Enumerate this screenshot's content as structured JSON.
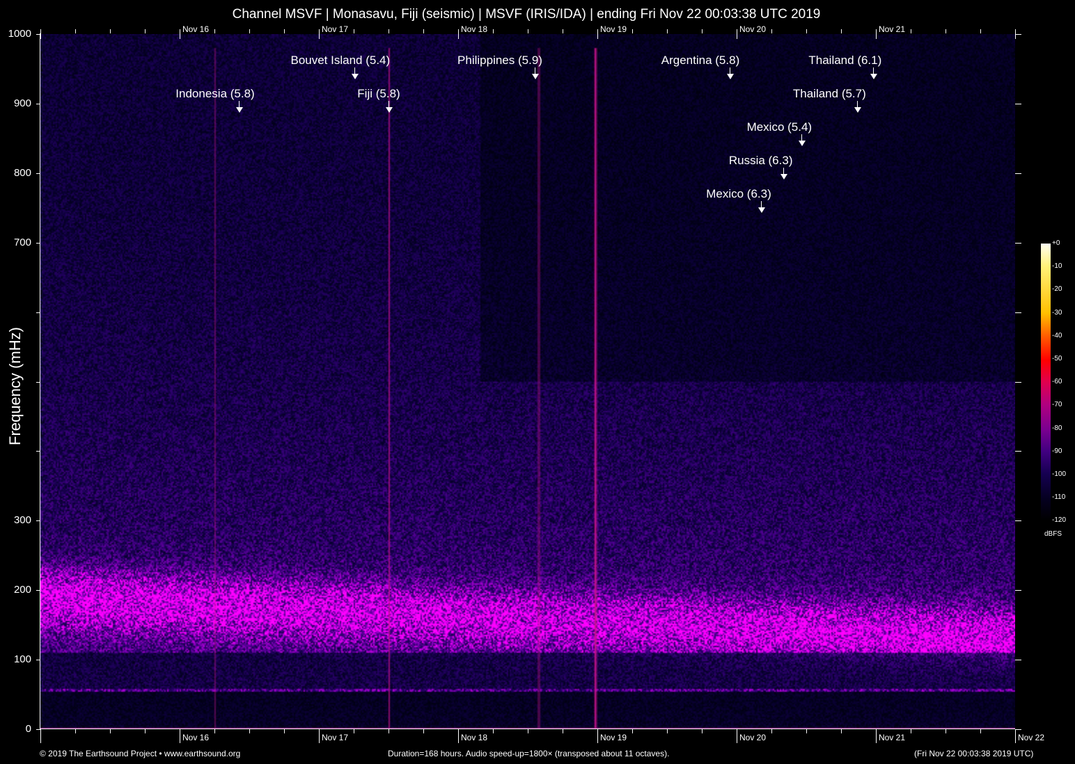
{
  "chart_data": {
    "type": "heatmap",
    "title": "Channel MSVF | Monasavu, Fiji (seismic) | MSVF (IRIS/IDA) | ending Fri Nov 22 00:03:38 UTC 2019",
    "ylabel": "Frequency (mHz)",
    "ylim": [
      0,
      1000
    ],
    "y_ticks": [
      0,
      100,
      200,
      300,
      400,
      500,
      600,
      700,
      800,
      900,
      1000
    ],
    "y_tick_labels": [
      "0",
      "100",
      "200",
      "300",
      "",
      "",
      "",
      "700",
      "800",
      "900",
      "1000"
    ],
    "x_duration_hours": 168,
    "x_tick_labels": [
      "Nov 16",
      "Nov 17",
      "Nov 18",
      "Nov 19",
      "Nov 20",
      "Nov 21",
      "Nov 22"
    ],
    "x_tick_hours": [
      24,
      48,
      72,
      96,
      120,
      144,
      168
    ],
    "colorbar": {
      "label": "dBFS",
      "ticks": [
        "+0",
        "-10",
        "-20",
        "-30",
        "-40",
        "-50",
        "-60",
        "-70",
        "-80",
        "-90",
        "-100",
        "-110",
        "-120"
      ],
      "range": [
        -120,
        0
      ]
    },
    "events": [
      {
        "label": "Indonesia (5.8)",
        "hour": 34.2
      },
      {
        "label": "Bouvet Island (5.4)",
        "hour": 54.1
      },
      {
        "label": "Fiji (5.8)",
        "hour": 60.0
      },
      {
        "label": "Philippines (5.9)",
        "hour": 85.2
      },
      {
        "label": "Argentina (5.8)",
        "hour": 118.8
      },
      {
        "label": "Thailand (6.1)",
        "hour": 143.5
      },
      {
        "label": "Thailand (5.7)",
        "hour": 140.8
      },
      {
        "label": "Mexico (5.4)",
        "hour": 131.2
      },
      {
        "label": "Russia (6.3)",
        "hour": 128.0
      },
      {
        "label": "Mexico (6.3)",
        "hour": 124.2
      }
    ]
  },
  "footer": {
    "left": "© 2019 The Earthsound Project • www.earthsound.org",
    "center": "Duration=168 hours. Audio speed-up=1800× (transposed about 11 octaves).",
    "right": "(Fri Nov 22 00:03:38 2019 UTC)"
  },
  "colors": {
    "axis": "#ffffff",
    "band": "#c0107f",
    "noise": "#2a0a8a"
  }
}
